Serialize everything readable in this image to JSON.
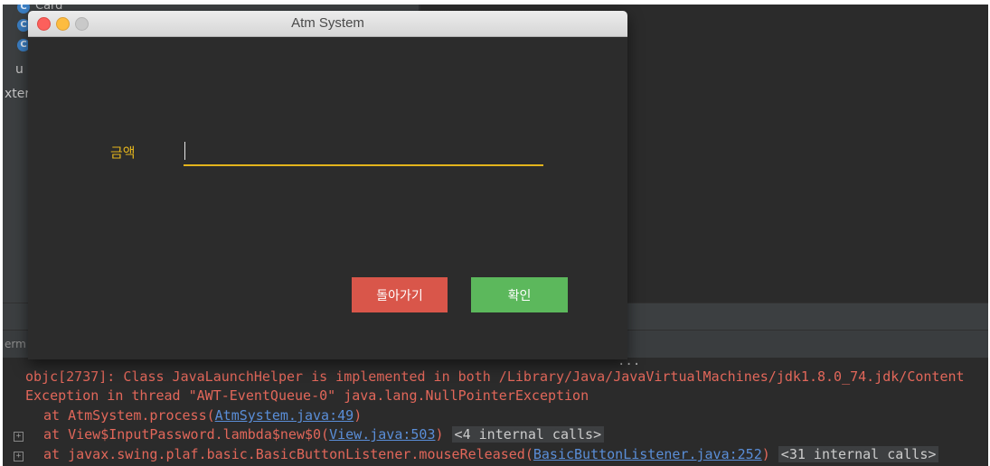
{
  "dialog": {
    "title": "Atm System",
    "amount_label": "금액",
    "amount_value": "",
    "back_label": "돌아가기",
    "ok_label": "확인"
  },
  "ide": {
    "project_rows": [
      {
        "icon": "C",
        "text": "Card"
      },
      {
        "icon": "C",
        "text": ""
      },
      {
        "icon": "C",
        "text": ""
      }
    ],
    "project_partial_1": "u",
    "project_partial_2": "xter",
    "terminal_tab_label": "erm",
    "console_dots": "...",
    "console": {
      "line1": "objc[2737]: Class JavaLaunchHelper is implemented in both /Library/Java/JavaVirtualMachines/jdk1.8.0_74.jdk/Content",
      "line2": "Exception in thread \"AWT-EventQueue-0\" java.lang.NullPointerException",
      "line3_pre": "at AtmSystem.process(",
      "line3_link": "AtmSystem.java:49",
      "line3_post": ")",
      "line4_pre": "at View$InputPassword.lambda$new$0(",
      "line4_link": "View.java:503",
      "line4_post": ")",
      "line4_internal": "<4 internal calls>",
      "line5_pre": "at javax.swing.plaf.basic.BasicButtonListener.mouseReleased(",
      "line5_link": "BasicButtonListener.java:252",
      "line5_post": ")",
      "line5_internal": "<31 internal calls>"
    }
  },
  "colors": {
    "accent_yellow": "#e3b41c",
    "back_button": "#d9564a",
    "ok_button": "#5cb85c",
    "error_text": "#e2675a",
    "link_text": "#5a8ed8"
  }
}
